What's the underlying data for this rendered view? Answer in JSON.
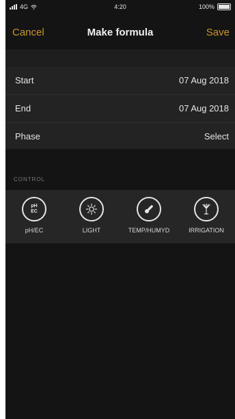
{
  "status_bar": {
    "carrier": "4G",
    "time": "4:20",
    "battery": "100%"
  },
  "nav": {
    "cancel_label": "Cancel",
    "title": "Make formula",
    "save_label": "Save"
  },
  "form": {
    "rows": [
      {
        "label": "Start",
        "value": "07 Aug 2018"
      },
      {
        "label": "End",
        "value": "07 Aug 2018"
      },
      {
        "label": "Phase",
        "value": "Select"
      }
    ]
  },
  "control_section": {
    "header": "CONTROL",
    "items": [
      {
        "label": "pH/EC",
        "icon": "ph-ec-icon",
        "icon_text_top": "pH",
        "icon_text_bottom": "EC"
      },
      {
        "label": "LIGHT",
        "icon": "sun-icon"
      },
      {
        "label": "TEMP/HUMYD",
        "icon": "thermometer-icon"
      },
      {
        "label": "IRRIGATION",
        "icon": "sprinkler-icon"
      }
    ]
  },
  "colors": {
    "accent": "#c8962e",
    "background": "#141414",
    "cell": "#232323"
  }
}
